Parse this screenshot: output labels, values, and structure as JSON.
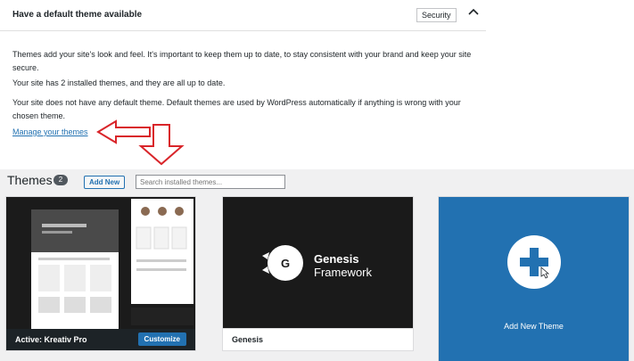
{
  "health_panel": {
    "title": "Have a default theme available",
    "badge": "Security",
    "paragraphs": [
      "Themes add your site's look and feel. It's important to keep them up to date, to stay consistent with your brand and keep your site secure.",
      "Your site has 2 installed themes, and they are all up to date.",
      "Your site does not have any default theme. Default themes are used by WordPress automatically if anything is wrong with your chosen theme."
    ],
    "manage_link": "Manage your themes"
  },
  "themes_header": {
    "title": "Themes",
    "count": "2",
    "add_new": "Add New",
    "search_placeholder": "Search installed themes..."
  },
  "themes": [
    {
      "active_prefix": "Active:",
      "name": "Kreativ Pro",
      "action": "Customize"
    },
    {
      "name": "Genesis",
      "logo_line1": "Genesis",
      "logo_line2": "Framework",
      "logo_letter": "G"
    },
    {
      "name": "Add New Theme"
    }
  ],
  "colors": {
    "accent": "#2271b1",
    "arrow": "#d9252a",
    "dark": "#1d2327"
  }
}
